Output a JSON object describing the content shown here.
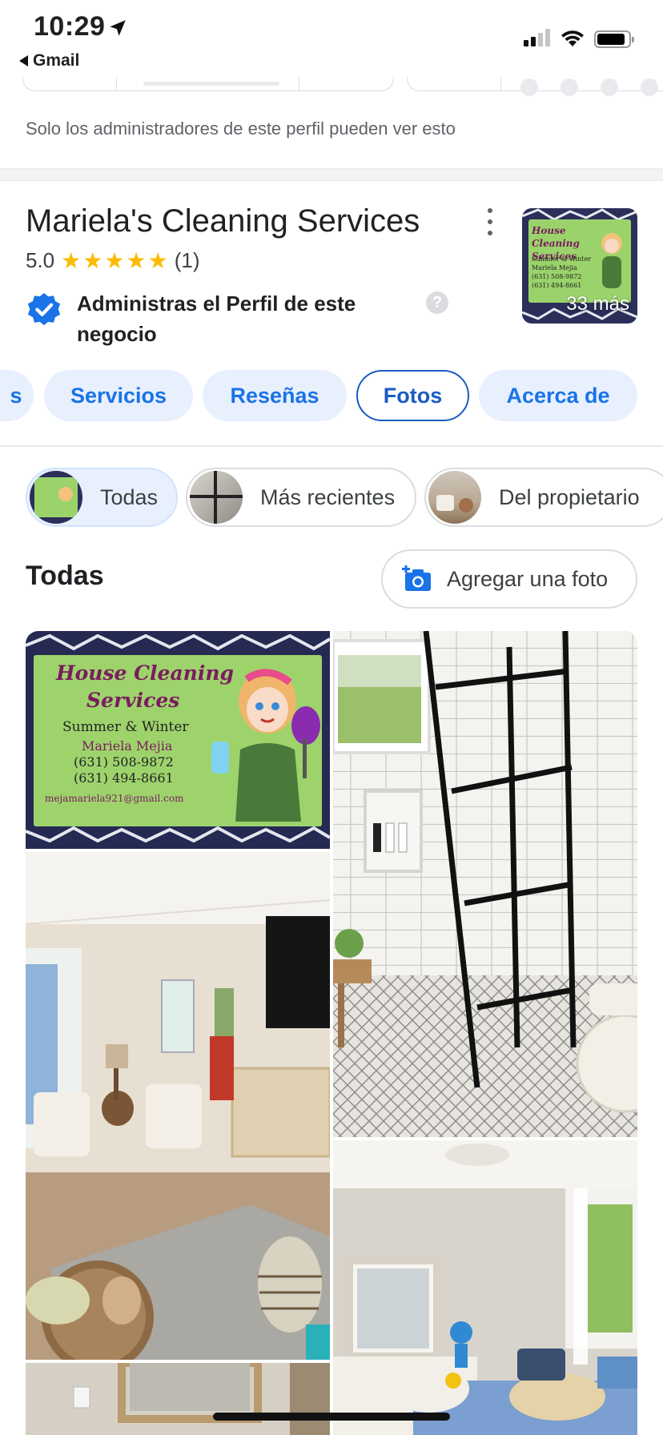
{
  "status_bar": {
    "time": "10:29",
    "back_app": "Gmail"
  },
  "admin_note": "Solo los administradores de este perfil pueden ver esto",
  "business": {
    "name": "Mariela's Cleaning Services",
    "rating": "5.0",
    "stars": 5,
    "review_count": "(1)",
    "verified_text": "Administras el Perfil de este negocio",
    "thumbnail_more": "33 más",
    "thumbnail_card_title": "House Cleaning Services",
    "thumbnail_card_lines": "Summer & Winter\nMariela Mejia\n(631) 508-9872\n(631) 494-8661"
  },
  "tabs": [
    {
      "label": "s"
    },
    {
      "label": "Servicios"
    },
    {
      "label": "Reseñas"
    },
    {
      "label": "Fotos",
      "active": true
    },
    {
      "label": "Acerca de"
    }
  ],
  "filters": [
    {
      "label": "Todas",
      "active": true
    },
    {
      "label": "Más recientes"
    },
    {
      "label": "Del propietario"
    }
  ],
  "section": {
    "title": "Todas",
    "add_photo_label": "Agregar una foto"
  },
  "business_card": {
    "title_line1": "House Cleaning",
    "title_line2": "Services",
    "subtitle": "Summer & Winter",
    "person": "Mariela Mejia",
    "phone1": "(631) 508-9872",
    "phone2": "(631) 494-8661",
    "email": "mejamariela921@gmail.com"
  },
  "colors": {
    "accent": "#1a73e8",
    "chip_bg": "#e8f0fe",
    "star": "#fbbc04",
    "card_green": "#9bd36b",
    "card_title": "#7a1c5e"
  },
  "icons": {
    "location": "location-arrow-icon",
    "verified": "verified-badge-icon",
    "help": "help-icon",
    "more": "more-vertical-icon",
    "camera": "add-photo-camera-icon"
  }
}
